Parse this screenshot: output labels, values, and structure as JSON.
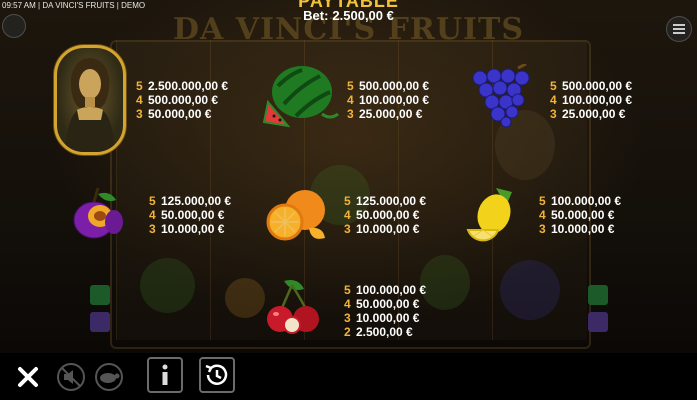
{
  "status_bar": {
    "time": "09:57 AM",
    "game": "DA VINCI'S FRUITS",
    "mode": "DEMO"
  },
  "background_title": "DA VINCI'S FRUITS",
  "paytable": {
    "title": "PAYTABLE",
    "bet_label": "Bet:",
    "bet_value": "2.500,00 €",
    "symbols": [
      {
        "name": "mona-lisa",
        "pays": [
          [
            "5",
            "2.500.000,00 €"
          ],
          [
            "4",
            "500.000,00 €"
          ],
          [
            "3",
            "50.000,00 €"
          ]
        ]
      },
      {
        "name": "watermelon",
        "pays": [
          [
            "5",
            "500.000,00 €"
          ],
          [
            "4",
            "100.000,00 €"
          ],
          [
            "3",
            "25.000,00 €"
          ]
        ]
      },
      {
        "name": "grapes",
        "pays": [
          [
            "5",
            "500.000,00 €"
          ],
          [
            "4",
            "100.000,00 €"
          ],
          [
            "3",
            "25.000,00 €"
          ]
        ]
      },
      {
        "name": "plum",
        "pays": [
          [
            "5",
            "125.000,00 €"
          ],
          [
            "4",
            "50.000,00 €"
          ],
          [
            "3",
            "10.000,00 €"
          ]
        ]
      },
      {
        "name": "orange",
        "pays": [
          [
            "5",
            "125.000,00 €"
          ],
          [
            "4",
            "50.000,00 €"
          ],
          [
            "3",
            "10.000,00 €"
          ]
        ]
      },
      {
        "name": "lemon",
        "pays": [
          [
            "5",
            "100.000,00 €"
          ],
          [
            "4",
            "50.000,00 €"
          ],
          [
            "3",
            "10.000,00 €"
          ]
        ]
      },
      {
        "name": "cherry",
        "pays": [
          [
            "5",
            "100.000,00 €"
          ],
          [
            "4",
            "50.000,00 €"
          ],
          [
            "3",
            "10.000,00 €"
          ],
          [
            "2",
            "2.500,00 €"
          ]
        ]
      }
    ]
  },
  "toolbar": {
    "buttons": [
      "close-icon",
      "sound-off-icon",
      "turbo-turtle-icon",
      "info-icon",
      "history-icon"
    ]
  }
}
